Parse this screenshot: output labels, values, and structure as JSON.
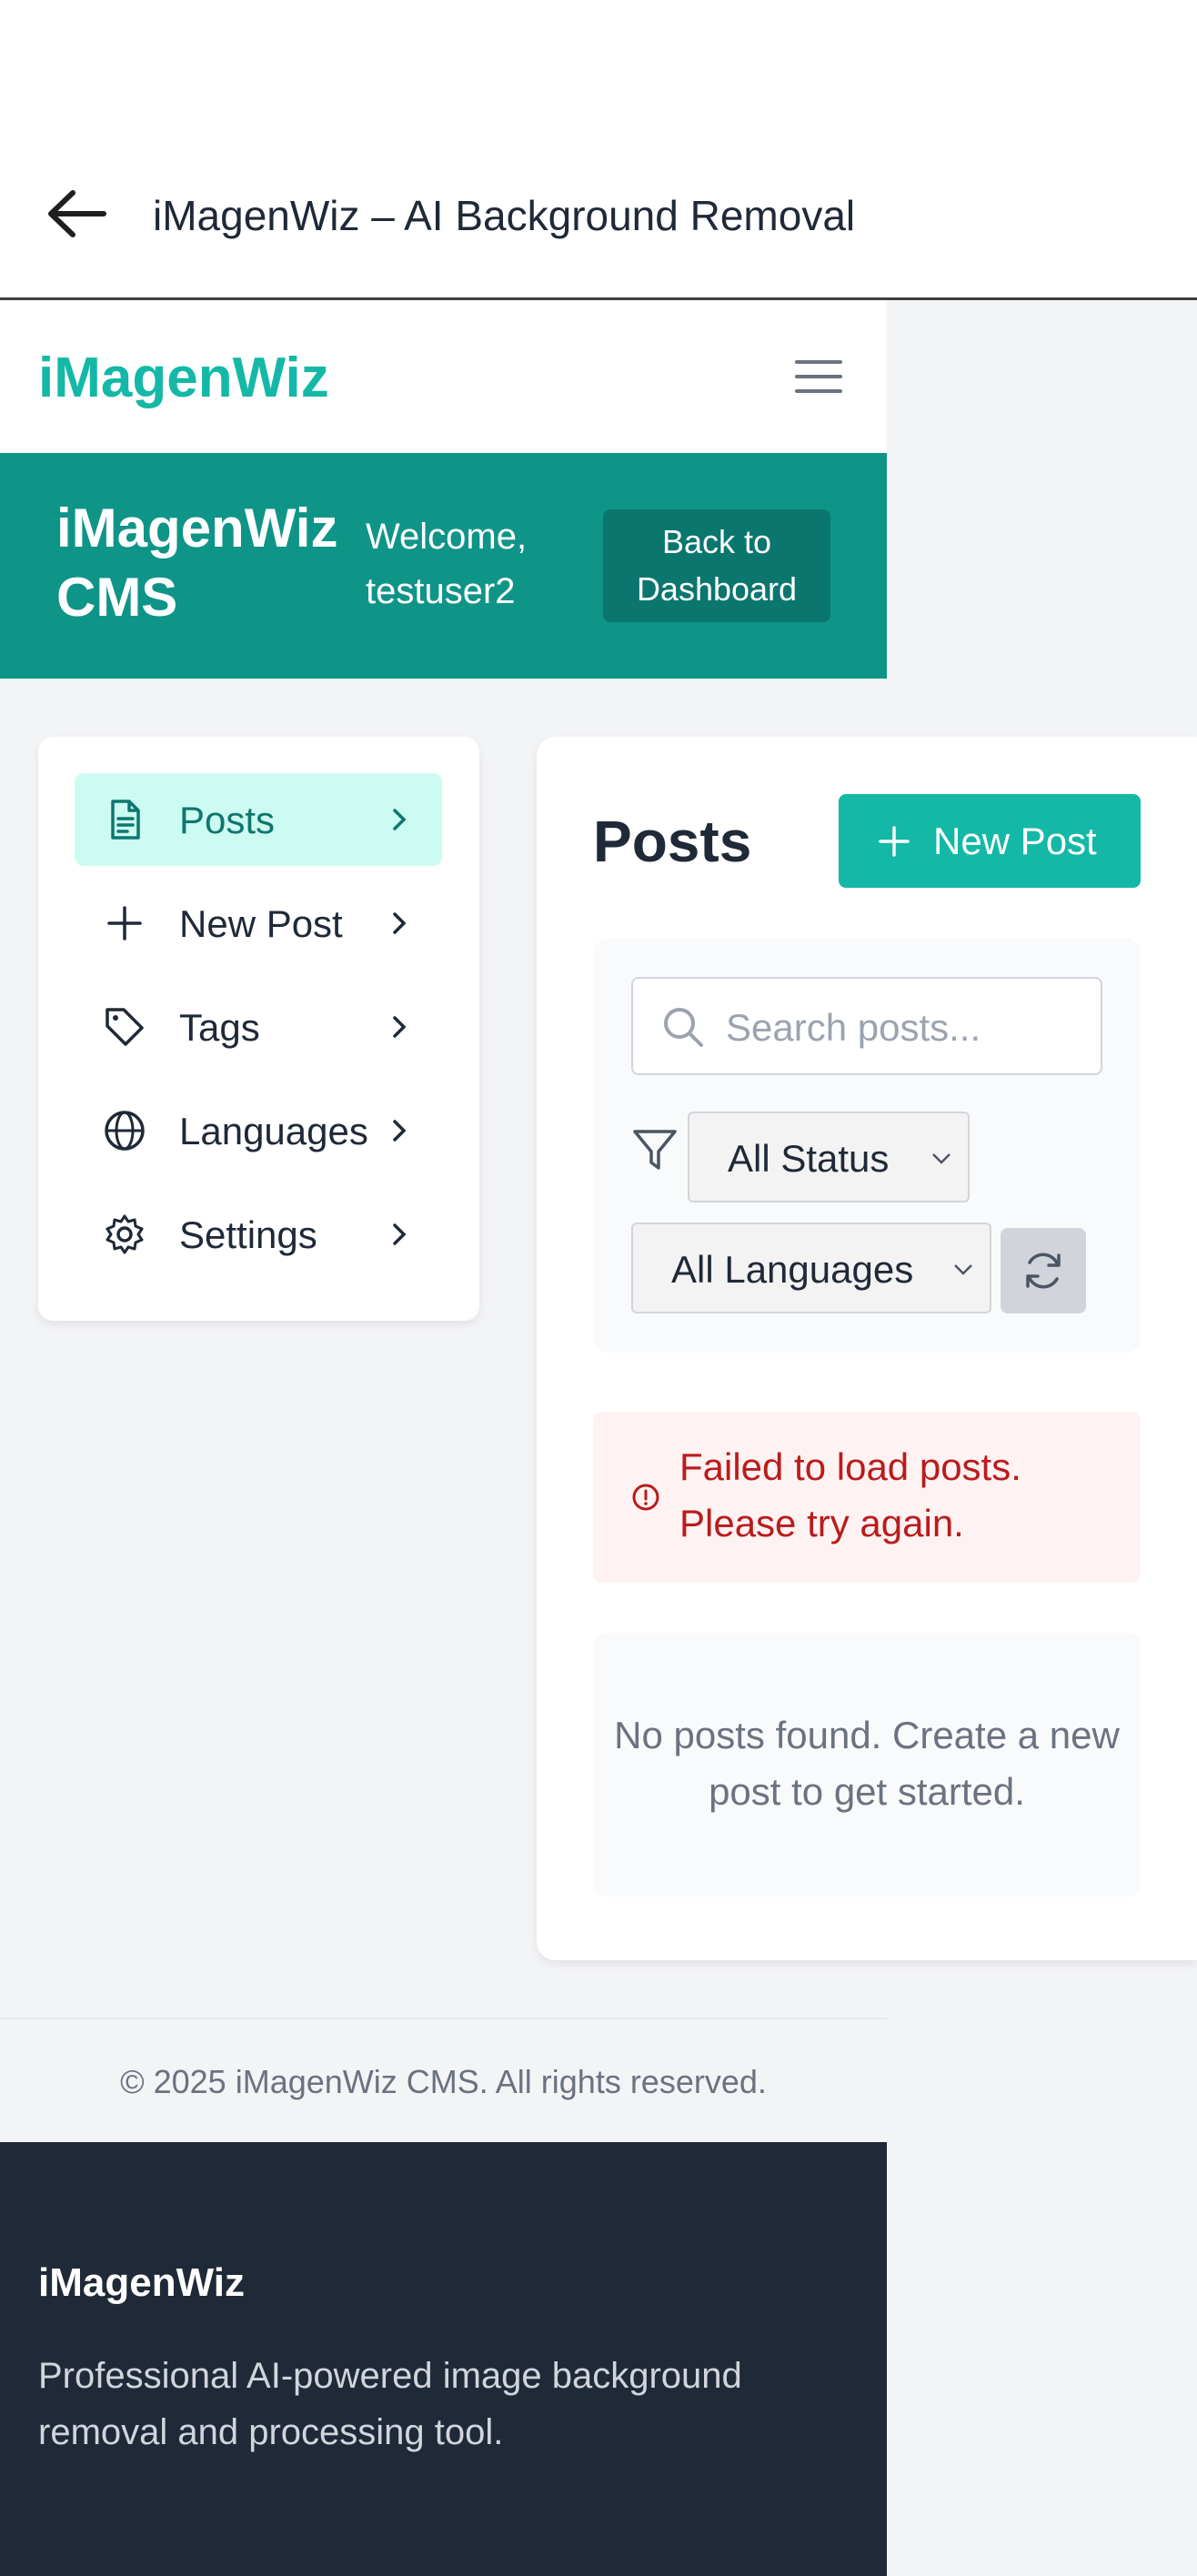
{
  "topbar": {
    "title": "iMagenWiz – AI Background Removal",
    "back_icon": "arrow-left-icon"
  },
  "header": {
    "logo": "iMagenWiz",
    "menu_icon": "hamburger-menu-icon"
  },
  "banner": {
    "title": "iMagenWiz CMS",
    "welcome": "Welcome, testuser2",
    "back_button": "Back to Dashboard",
    "bg_color": "#0f9488"
  },
  "sidebar": {
    "items": [
      {
        "label": "Posts",
        "icon": "document-icon",
        "active": true
      },
      {
        "label": "New Post",
        "icon": "plus-icon",
        "active": false
      },
      {
        "label": "Tags",
        "icon": "tag-icon",
        "active": false
      },
      {
        "label": "Languages",
        "icon": "globe-icon",
        "active": false
      },
      {
        "label": "Settings",
        "icon": "gear-icon",
        "active": false
      }
    ]
  },
  "main": {
    "title": "Posts",
    "new_post_button": "New Post",
    "search": {
      "placeholder": "Search posts...",
      "value": ""
    },
    "status_filter": {
      "selected": "All Status"
    },
    "language_filter": {
      "selected": "All Languages"
    },
    "error_message": "Failed to load posts. Please try again.",
    "empty_message": "No posts found. Create a new post to get started."
  },
  "footer": {
    "copyright": "© 2025 iMagenWiz CMS. All rights reserved.",
    "brand": "iMagenWiz",
    "description": "Professional AI-powered image background removal and processing tool."
  },
  "colors": {
    "accent": "#14b8a6",
    "dark": "#1f2937",
    "error": "#b91c1c"
  }
}
